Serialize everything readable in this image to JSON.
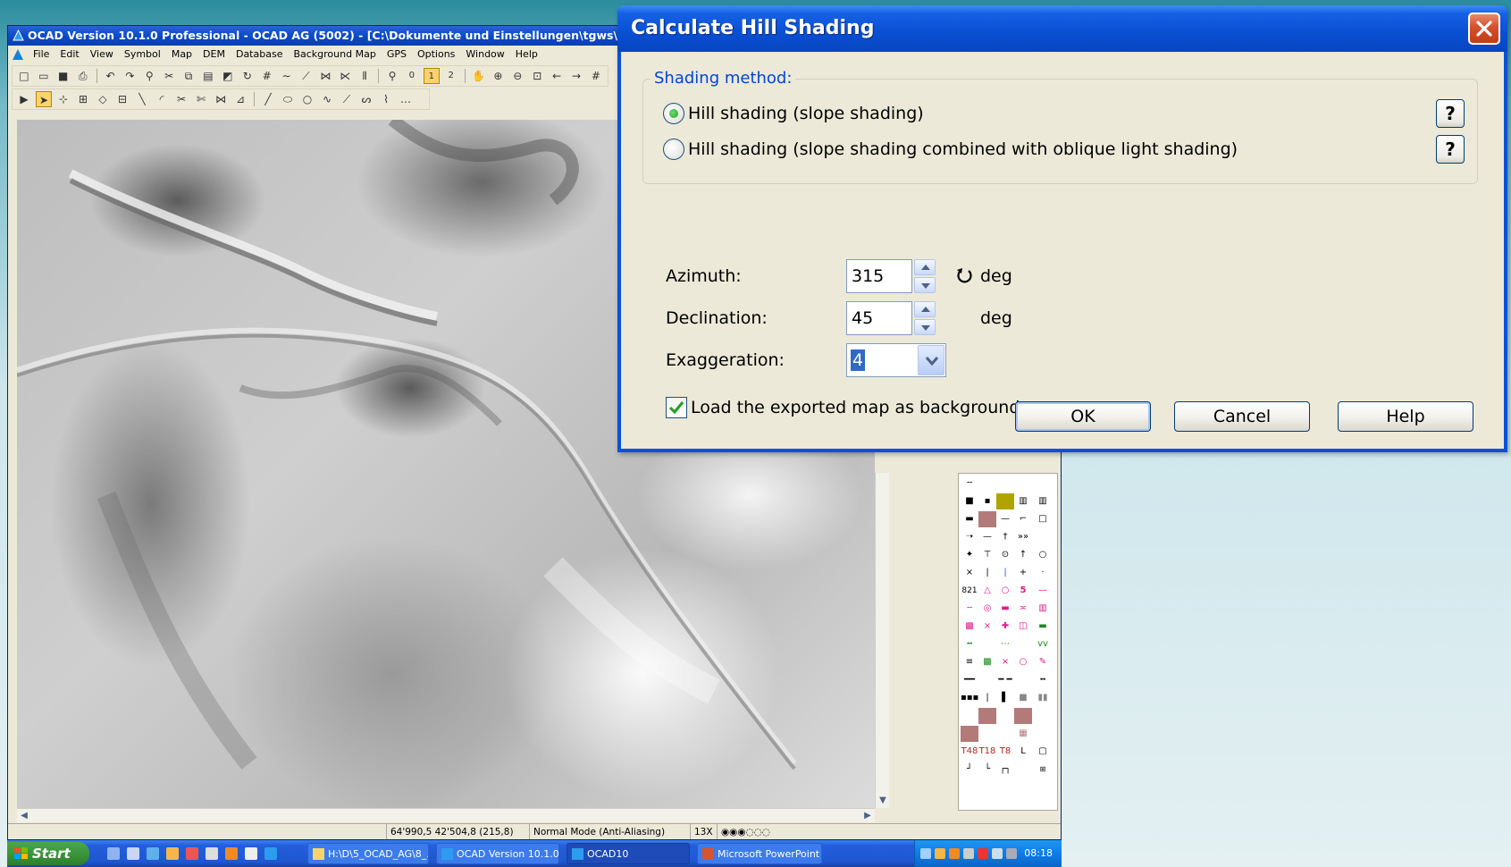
{
  "ocad": {
    "title": "OCAD Version 10.1.0  Professional - OCAD AG (5002) - [C:\\Dokumente und Einstellungen\\tgws\\Desktop\\Legend Orien",
    "menu": [
      "File",
      "Edit",
      "View",
      "Symbol",
      "Map",
      "DEM",
      "Database",
      "Background Map",
      "GPS",
      "Options",
      "Window",
      "Help"
    ],
    "toolbar_numbers": [
      "0",
      "1",
      "2"
    ],
    "status": {
      "coords": "64'990,5   42'504,8  (215,8)",
      "mode": "Normal Mode (Anti-Aliasing)",
      "zoom": "13X"
    },
    "symbol_labels": {
      "number_821": "821",
      "number_5": "5",
      "text_t48": "T48",
      "text_t18": "T18",
      "text_t8": "T8",
      "letter_l": "L"
    }
  },
  "taskbar": {
    "start_label": "Start",
    "tasks": [
      {
        "label": "H:\\D\\5_OCAD_AG\\8_..."
      },
      {
        "label": "OCAD Version 10.1.0..."
      },
      {
        "label": "OCAD10"
      },
      {
        "label": "Microsoft PowerPoint ..."
      }
    ],
    "clock": "08:18"
  },
  "dialog": {
    "title": "Calculate Hill Shading",
    "shading_method_legend": "Shading method:",
    "options": [
      {
        "label": "Hill shading (slope shading)",
        "checked": true
      },
      {
        "label": "Hill shading (slope shading combined with oblique light shading)",
        "checked": false
      }
    ],
    "help_q": "?",
    "azimuth_label": "Azimuth:",
    "azimuth_value": "315",
    "azimuth_unit": "deg",
    "declination_label": "Declination:",
    "declination_value": "45",
    "declination_unit": "deg",
    "exaggeration_label": "Exaggeration:",
    "exaggeration_value": "4",
    "load_checkbox_label": "Load the exported map as background map.",
    "load_checked": true,
    "ok_label": "OK",
    "cancel_label": "Cancel",
    "help_label": "Help"
  },
  "colors": {
    "xp_blue": "#0a52d4",
    "dialog_face": "#ece9d8",
    "legend_blue": "#0046d5",
    "taskbar_blue": "#245edb",
    "start_green": "#3a963a"
  }
}
